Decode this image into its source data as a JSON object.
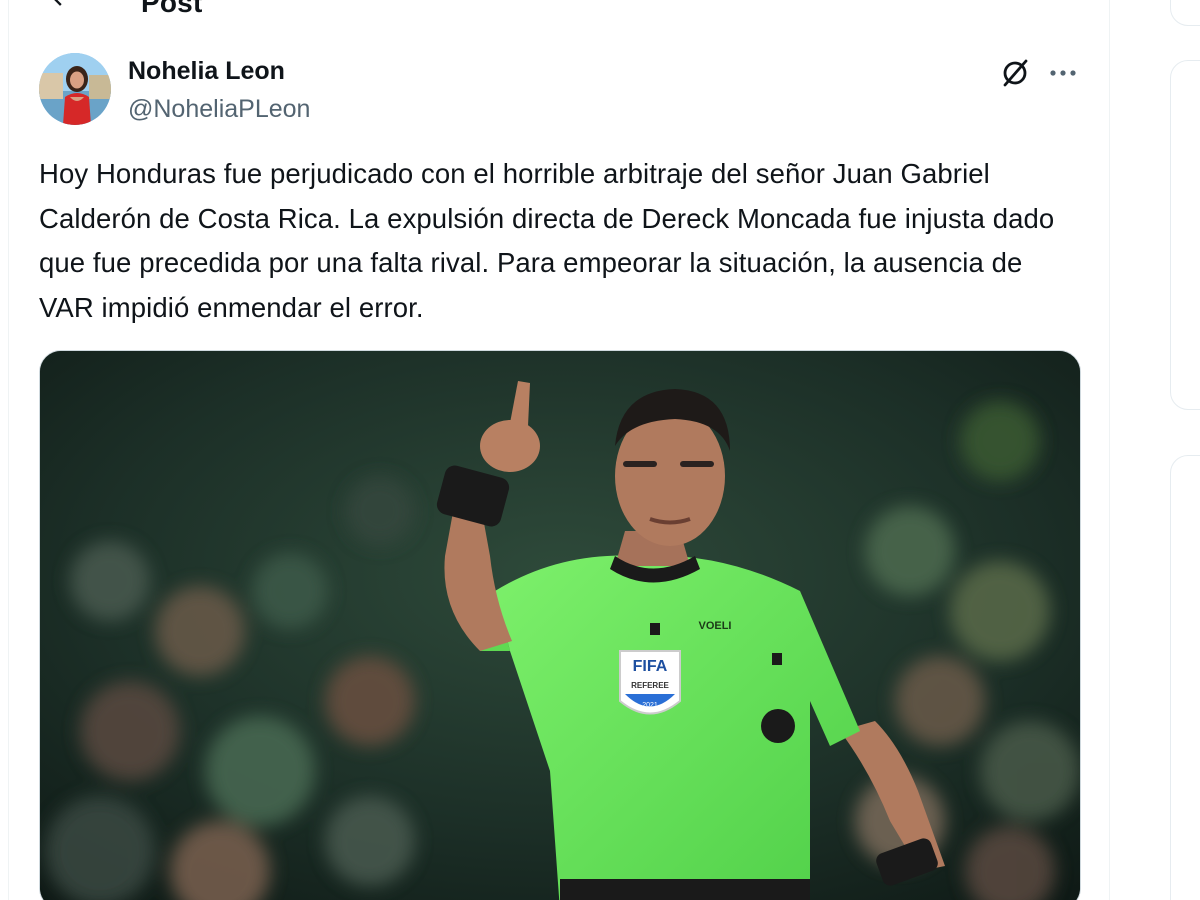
{
  "header": {
    "title": "Post",
    "back_icon": "arrow-left-icon"
  },
  "post": {
    "author": {
      "display_name": "Nohelia Leon",
      "handle": "@NoheliaPLeon"
    },
    "text": "Hoy Honduras fue perjudicado con el horrible arbitraje del señor Juan Gabriel Calderón de Costa Rica. La expulsión directa de Dereck Moncada fue injusta dado que fue precedida por una falta rival. Para empeorar la situación, la ausencia de VAR impidió enmendar el error.",
    "actions": {
      "grok_icon": "grok-icon",
      "more_icon": "more-horizontal-icon"
    },
    "media": {
      "badge_text": "FIFA",
      "badge_sub": "REFEREE",
      "badge_year": "2021",
      "brand_text": "VOELI"
    }
  },
  "colors": {
    "text_primary": "#0f1419",
    "text_secondary": "#536471",
    "border": "#eff3f4",
    "referee_shirt": "#63e25a"
  }
}
